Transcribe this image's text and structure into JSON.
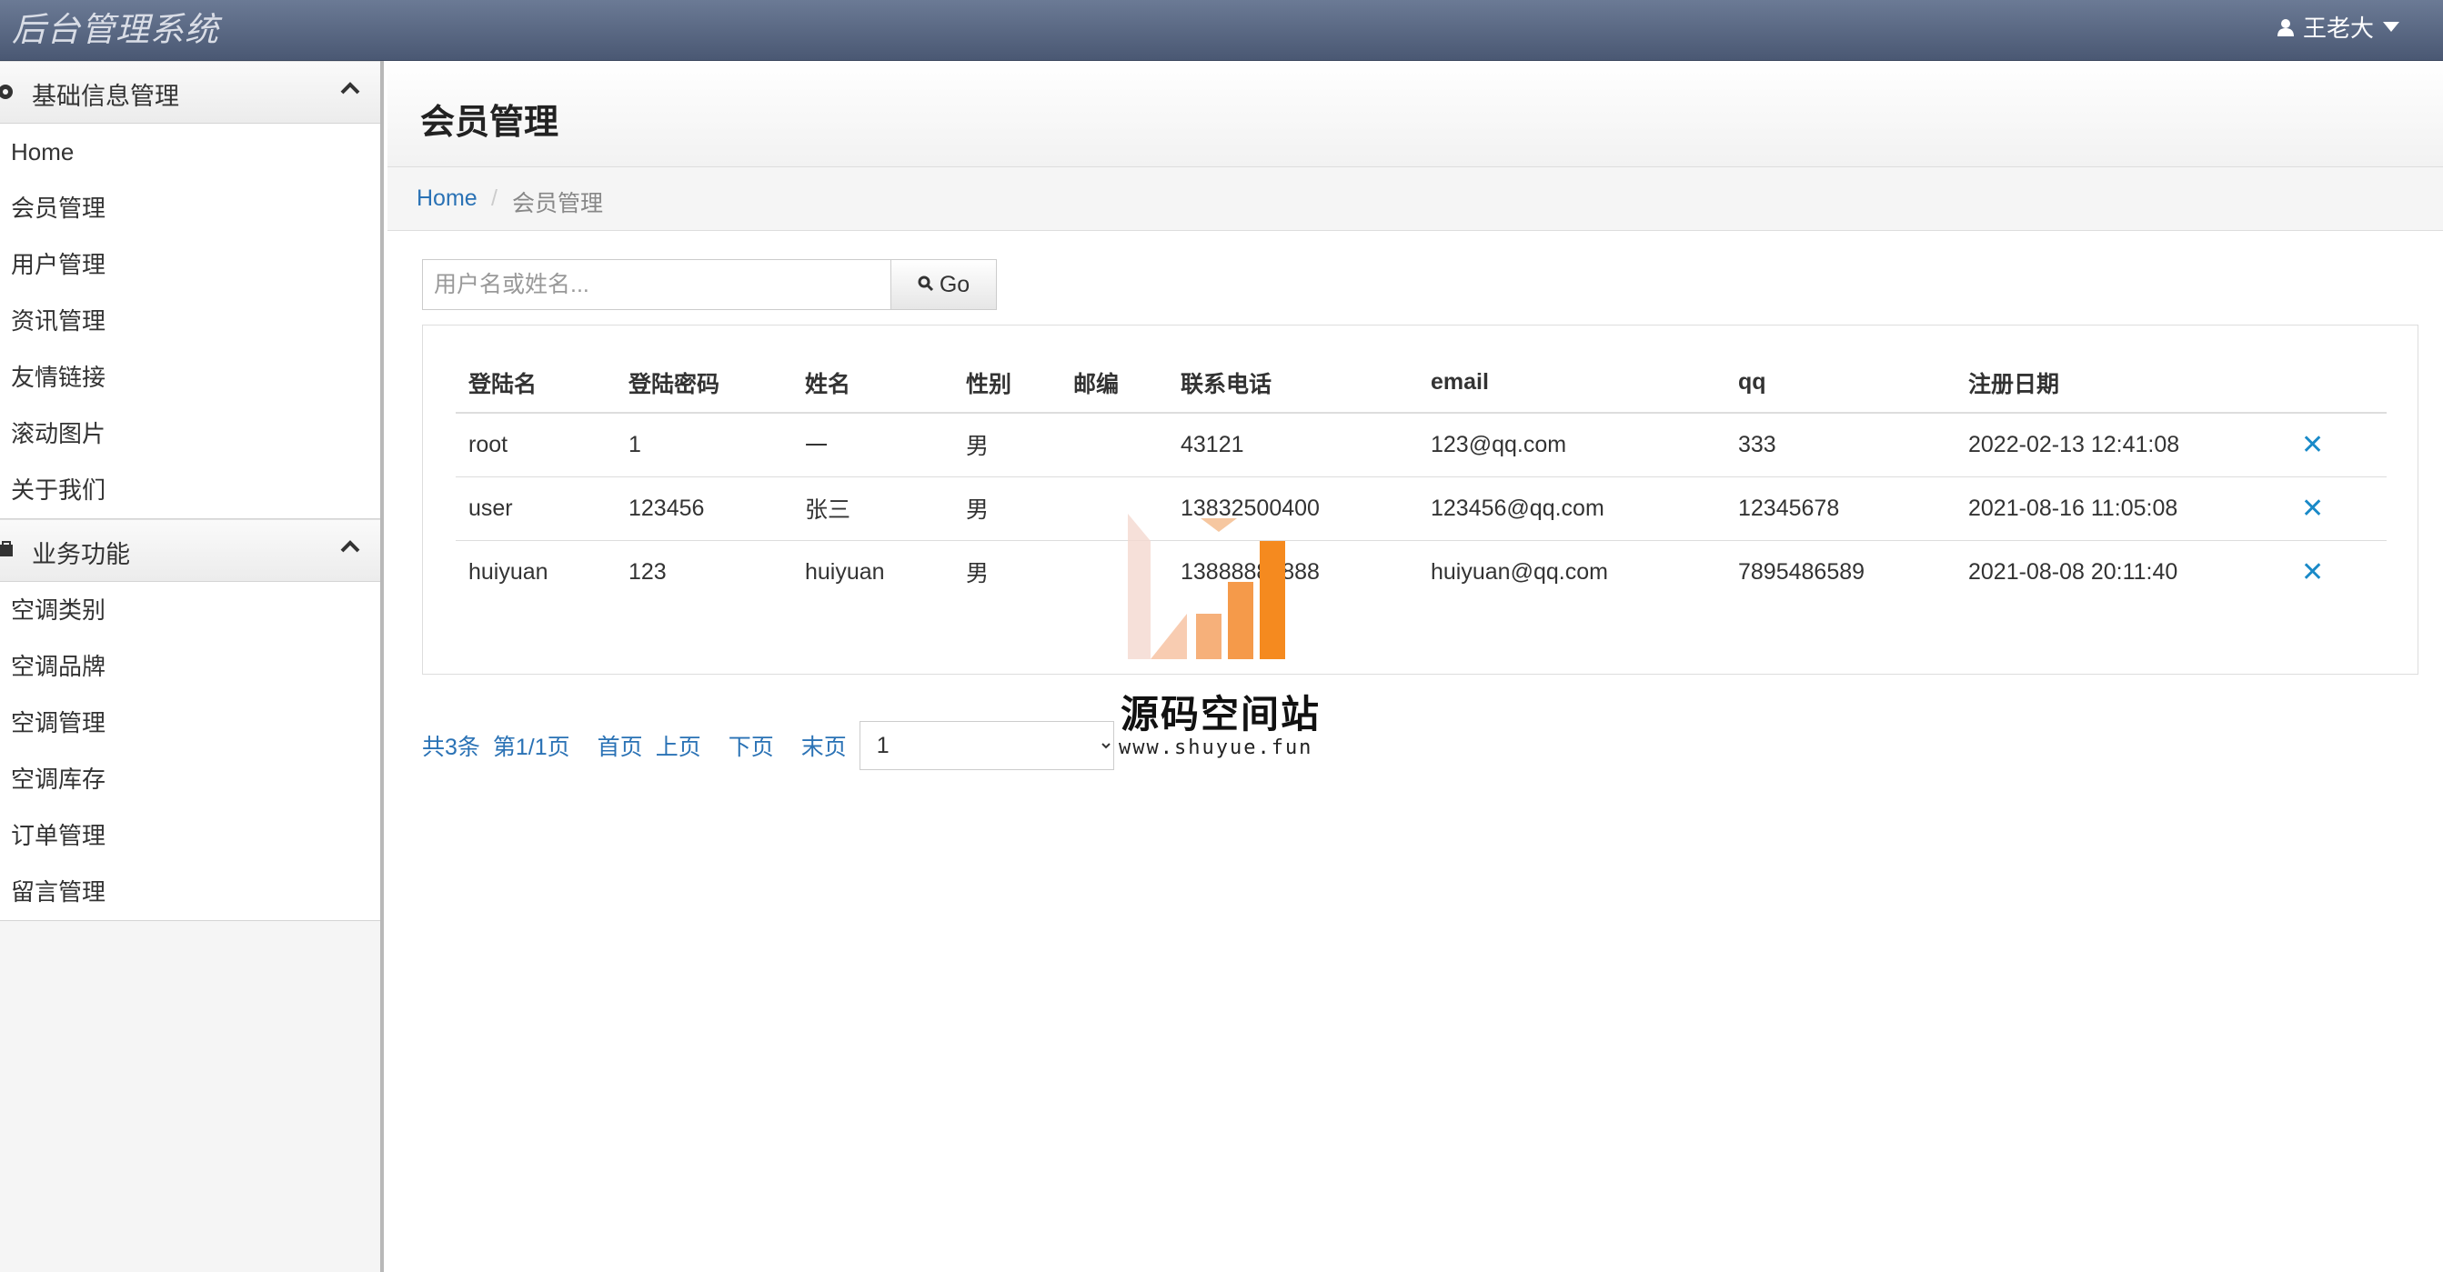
{
  "app": {
    "title": "后台管理系统",
    "user": "王老大"
  },
  "sidebar": {
    "groups": [
      {
        "label": "基础信息管理",
        "items": [
          "Home",
          "会员管理",
          "用户管理",
          "资讯管理",
          "友情链接",
          "滚动图片",
          "关于我们"
        ]
      },
      {
        "label": "业务功能",
        "items": [
          "空调类别",
          "空调品牌",
          "空调管理",
          "空调库存",
          "订单管理",
          "留言管理"
        ]
      }
    ]
  },
  "page": {
    "title": "会员管理",
    "breadcrumb": {
      "home": "Home",
      "sep": "/",
      "current": "会员管理"
    }
  },
  "search": {
    "placeholder": "用户名或姓名...",
    "button": "Go"
  },
  "table": {
    "columns": [
      "登陆名",
      "登陆密码",
      "姓名",
      "性别",
      "邮编",
      "联系电话",
      "email",
      "qq",
      "注册日期"
    ],
    "rows": [
      [
        "root",
        "1",
        "一",
        "男",
        "",
        "43121",
        "123@qq.com",
        "333",
        "2022-02-13 12:41:08"
      ],
      [
        "user",
        "123456",
        "张三",
        "男",
        "",
        "13832500400",
        "123456@qq.com",
        "12345678",
        "2021-08-16 11:05:08"
      ],
      [
        "huiyuan",
        "123",
        "huiyuan",
        "男",
        "",
        "13888888888",
        "huiyuan@qq.com",
        "7895486589",
        "2021-08-08 20:11:40"
      ]
    ],
    "delete_symbol": "✕"
  },
  "pager": {
    "total": "共3条",
    "page": "第1/1页",
    "first": "首页",
    "prev": "上页",
    "next": "下页",
    "last": "末页",
    "select_value": "1"
  },
  "watermark": {
    "title": "源码空间站",
    "url": "www.shuyue.fun"
  }
}
